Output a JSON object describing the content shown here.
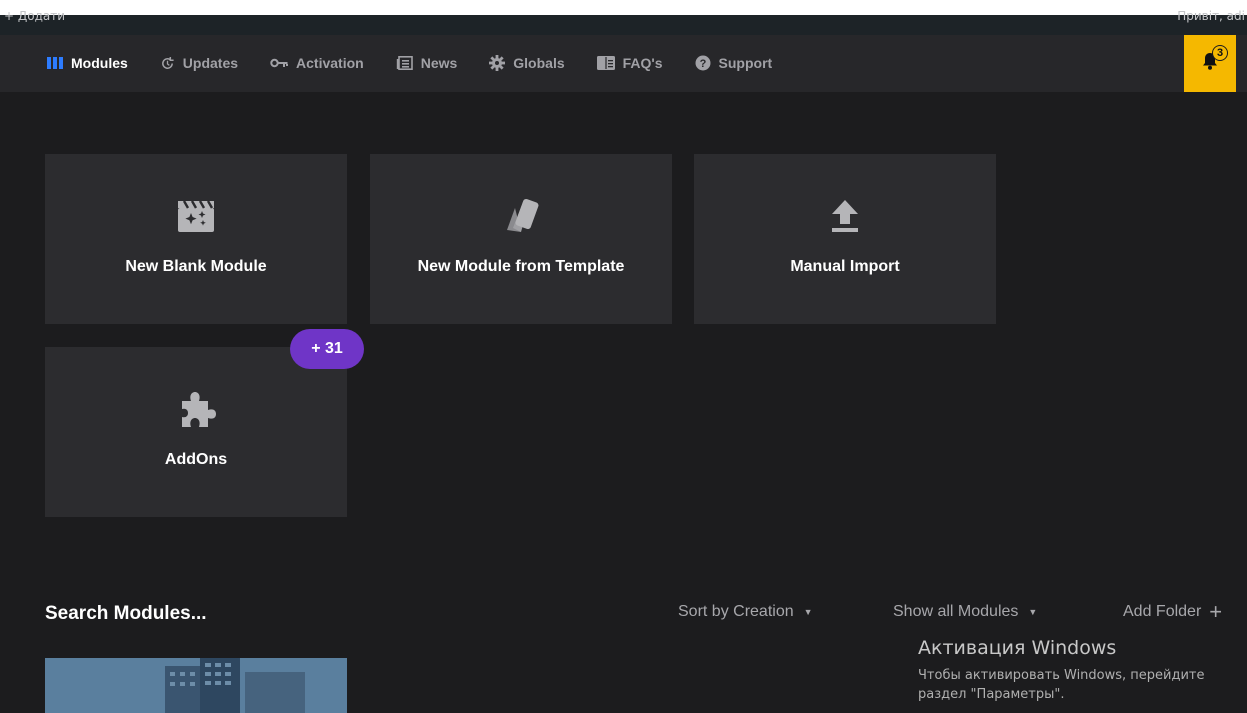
{
  "admin_bar": {
    "add_new": "+ Додати",
    "greeting": "Привіт, adi"
  },
  "nav": {
    "items": [
      {
        "label": "Modules",
        "icon": "modules-icon",
        "active": true
      },
      {
        "label": "Updates",
        "icon": "updates-icon",
        "active": false
      },
      {
        "label": "Activation",
        "icon": "key-icon",
        "active": false
      },
      {
        "label": "News",
        "icon": "news-icon",
        "active": false
      },
      {
        "label": "Globals",
        "icon": "gear-icon",
        "active": false
      },
      {
        "label": "FAQ's",
        "icon": "book-icon",
        "active": false
      },
      {
        "label": "Support",
        "icon": "question-icon",
        "active": false
      }
    ],
    "notifications_count": "3"
  },
  "cards": {
    "blank": "New Blank Module",
    "template": "New Module from Template",
    "import": "Manual Import",
    "addons": "AddOns",
    "addons_badge": "+ 31"
  },
  "list_controls": {
    "search_title": "Search Modules...",
    "sort": "Sort by Creation",
    "filter": "Show all Modules",
    "add_folder": "Add Folder"
  },
  "windows_watermark": {
    "title": "Активация Windows",
    "line1": "Чтобы активировать Windows, перейдите",
    "line2": "раздел \"Параметры\"."
  },
  "colors": {
    "background": "#1c1c1e",
    "navbar": "#27272a",
    "card": "#2c2c2f",
    "accent_blue": "#2d7cff",
    "bell_yellow": "#f5b800",
    "badge_purple": "#6f35c7"
  }
}
